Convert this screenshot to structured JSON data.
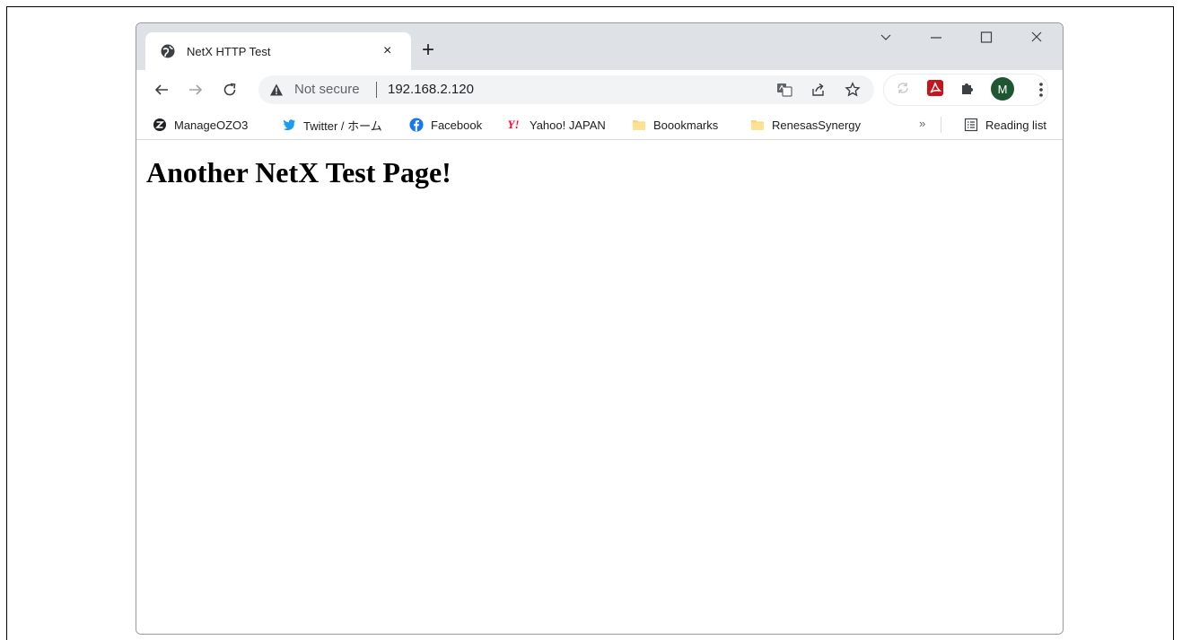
{
  "tab": {
    "title": "NetX HTTP Test",
    "close": "×",
    "new_tab": "+"
  },
  "window_controls": {
    "dropdown": "⌵",
    "minimize": "—",
    "maximize": "☐",
    "close": "✕"
  },
  "omnibox": {
    "security_label": "Not secure",
    "url": "192.168.2.120"
  },
  "profile": {
    "initial": "M",
    "color": "#1e5631"
  },
  "bookmarks": [
    {
      "label": "ManageOZO3",
      "icon": "z-logo-icon"
    },
    {
      "label": "Twitter / ホーム",
      "icon": "twitter-bird-icon"
    },
    {
      "label": "Facebook",
      "icon": "facebook-icon"
    },
    {
      "label": "Yahoo! JAPAN",
      "icon": "yahoo-icon"
    },
    {
      "label": "Boookmarks",
      "icon": "folder-icon"
    },
    {
      "label": "RenesasSynergy",
      "icon": "folder-icon"
    }
  ],
  "bookmarks_more": "»",
  "reading_list": "Reading list",
  "page": {
    "heading": "Another NetX Test Page!"
  }
}
